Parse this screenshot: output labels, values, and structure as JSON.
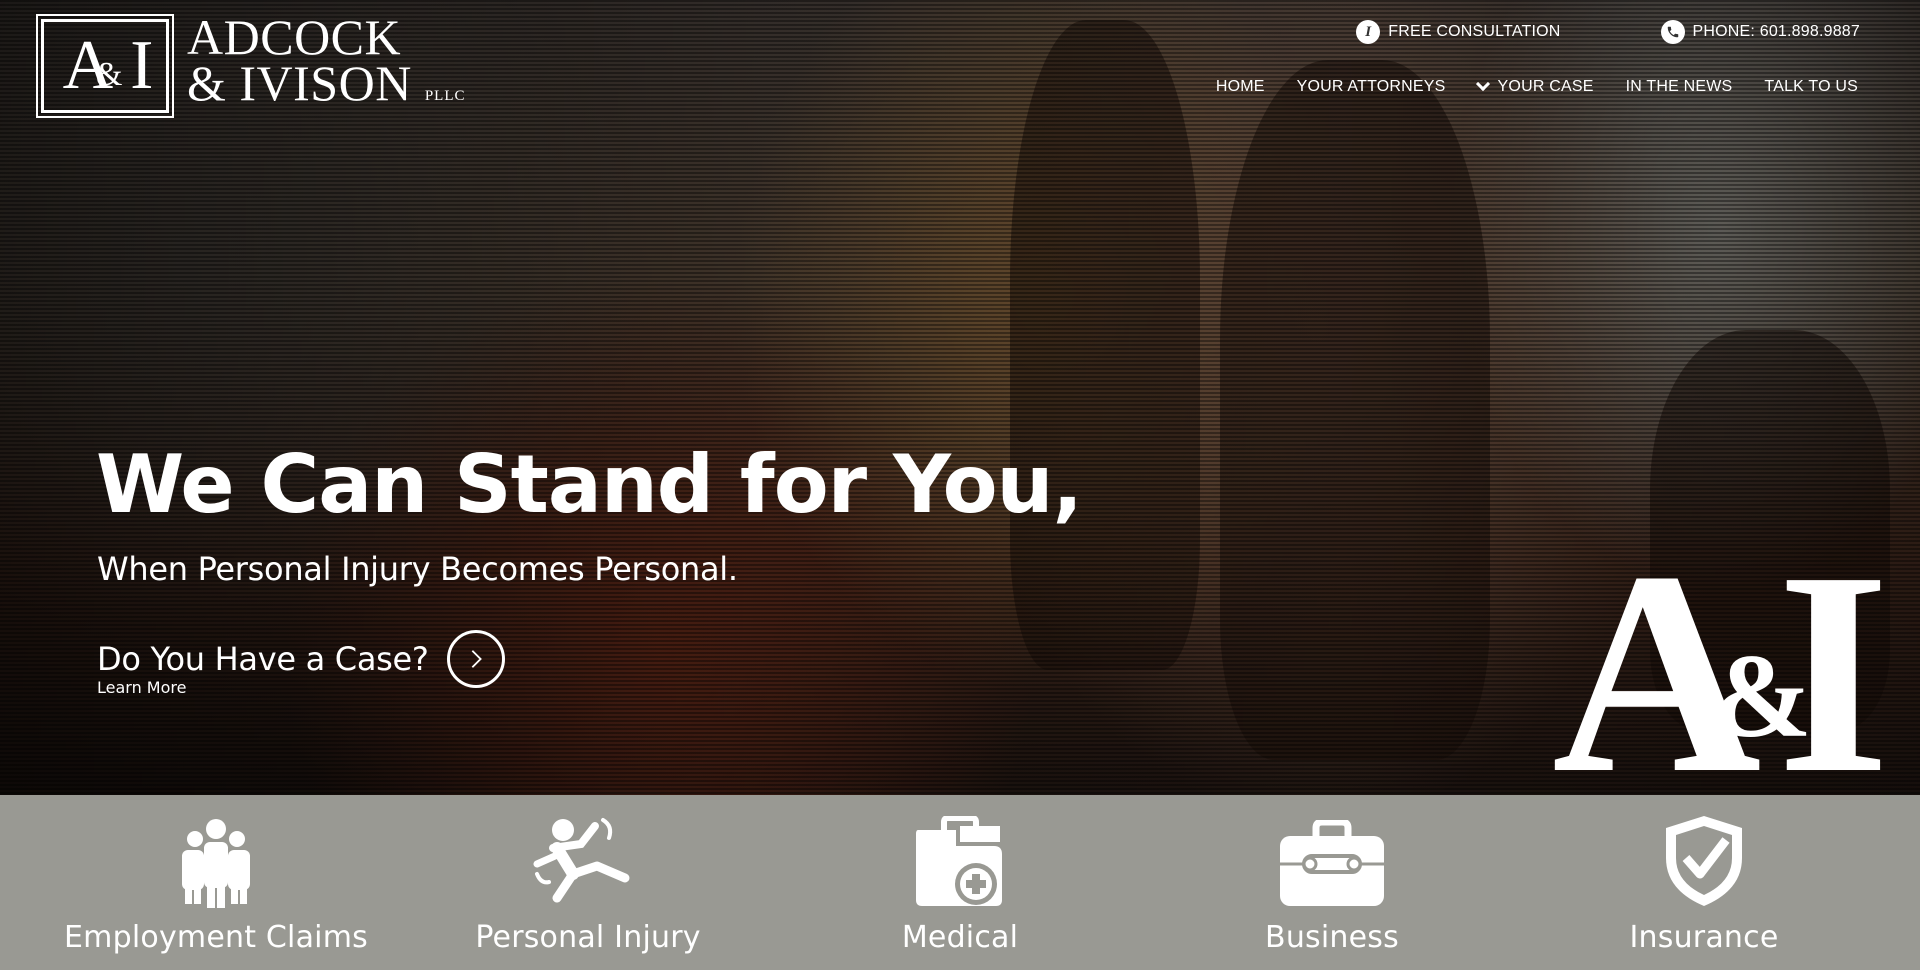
{
  "brand": {
    "logo_mark": "A&I",
    "name_line1": "ADCOCK",
    "name_line2": "& IVISON",
    "suffix": "PLLC"
  },
  "utility": {
    "consultation": {
      "icon": "info-icon",
      "label": "FREE CONSULTATION"
    },
    "phone": {
      "icon": "phone-icon",
      "label": "PHONE: 601.898.9887"
    }
  },
  "nav": {
    "items": [
      {
        "label": "HOME"
      },
      {
        "label": "YOUR ATTORNEYS"
      },
      {
        "label": "YOUR CASE",
        "icon": "chevron-down-icon"
      },
      {
        "label": "IN THE NEWS"
      },
      {
        "label": "TALK TO US"
      }
    ]
  },
  "hero": {
    "headline": "We Can Stand for You,",
    "subhead": "When Personal Injury Becomes Personal.",
    "cta_title": "Do You Have a Case?",
    "cta_sub": "Learn More",
    "mark": {
      "a": "A",
      "amp": "&",
      "i": "I"
    }
  },
  "services": [
    {
      "label": "Employment Claims",
      "icon": "people-group-icon"
    },
    {
      "label": "Personal Injury",
      "icon": "person-falling-icon"
    },
    {
      "label": "Medical",
      "icon": "medical-file-icon"
    },
    {
      "label": "Business",
      "icon": "briefcase-icon"
    },
    {
      "label": "Insurance",
      "icon": "shield-check-icon"
    }
  ],
  "colors": {
    "services_bar": "#999993",
    "text": "#ffffff"
  }
}
